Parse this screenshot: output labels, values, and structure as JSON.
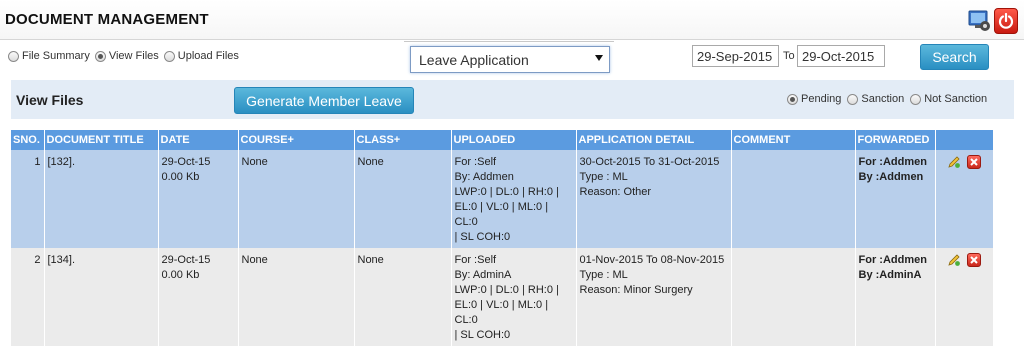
{
  "app": {
    "title": "DOCUMENT MANAGEMENT"
  },
  "icons": {
    "settings": "settings-monitor-icon",
    "power": "power-icon",
    "edit": "pencil-edit-icon",
    "delete": "delete-x-icon"
  },
  "colors": {
    "header_blue": "#5b9be0",
    "row_selected": "#b8cfeb",
    "row_normal": "#ebebeb",
    "button_blue": "#2a8fc2",
    "power_red": "#d3261a"
  },
  "modes": [
    {
      "label": "File Summary",
      "checked": false
    },
    {
      "label": "View Files",
      "checked": true
    },
    {
      "label": "Upload Files",
      "checked": false
    }
  ],
  "filter": {
    "category": "Leave Application",
    "date_from": "29-Sep-2015",
    "to_label": "To",
    "date_to": "29-Oct-2015",
    "search_label": "Search"
  },
  "panel": {
    "title": "View Files",
    "generate_label": "Generate Member Leave",
    "statuses": [
      {
        "label": "Pending",
        "checked": true
      },
      {
        "label": "Sanction",
        "checked": false
      },
      {
        "label": "Not Sanction",
        "checked": false
      }
    ]
  },
  "table": {
    "headers": [
      "SNO.",
      "DOCUMENT TITLE",
      "DATE",
      "COURSE+",
      "CLASS+",
      "UPLOADED",
      "APPLICATION DETAIL",
      "COMMENT",
      "FORWARDED",
      ""
    ],
    "rows": [
      {
        "sno": "1",
        "title": "[132].",
        "date": "29-Oct-15",
        "size": "0.00 Kb",
        "course": "None",
        "class": "None",
        "uploaded": [
          "For :Self",
          "By: Addmen",
          "LWP:0 | DL:0 | RH:0 |",
          "EL:0 | VL:0 | ML:0 | CL:0",
          "| SL COH:0"
        ],
        "detail": [
          "30-Oct-2015 To 31-Oct-2015",
          "Type : ML",
          "Reason: Other"
        ],
        "comment": "",
        "forwarded": [
          "For :Addmen",
          "By :Addmen"
        ]
      },
      {
        "sno": "2",
        "title": "[134].",
        "date": "29-Oct-15",
        "size": "0.00 Kb",
        "course": "None",
        "class": "None",
        "uploaded": [
          "For :Self",
          "By: AdminA",
          "LWP:0 | DL:0 | RH:0 |",
          "EL:0 | VL:0 | ML:0 | CL:0",
          "| SL COH:0"
        ],
        "detail": [
          "01-Nov-2015 To 08-Nov-2015",
          "Type : ML",
          "Reason: Minor Surgery"
        ],
        "comment": "",
        "forwarded": [
          "For :Addmen",
          "By :AdminA"
        ]
      }
    ]
  }
}
